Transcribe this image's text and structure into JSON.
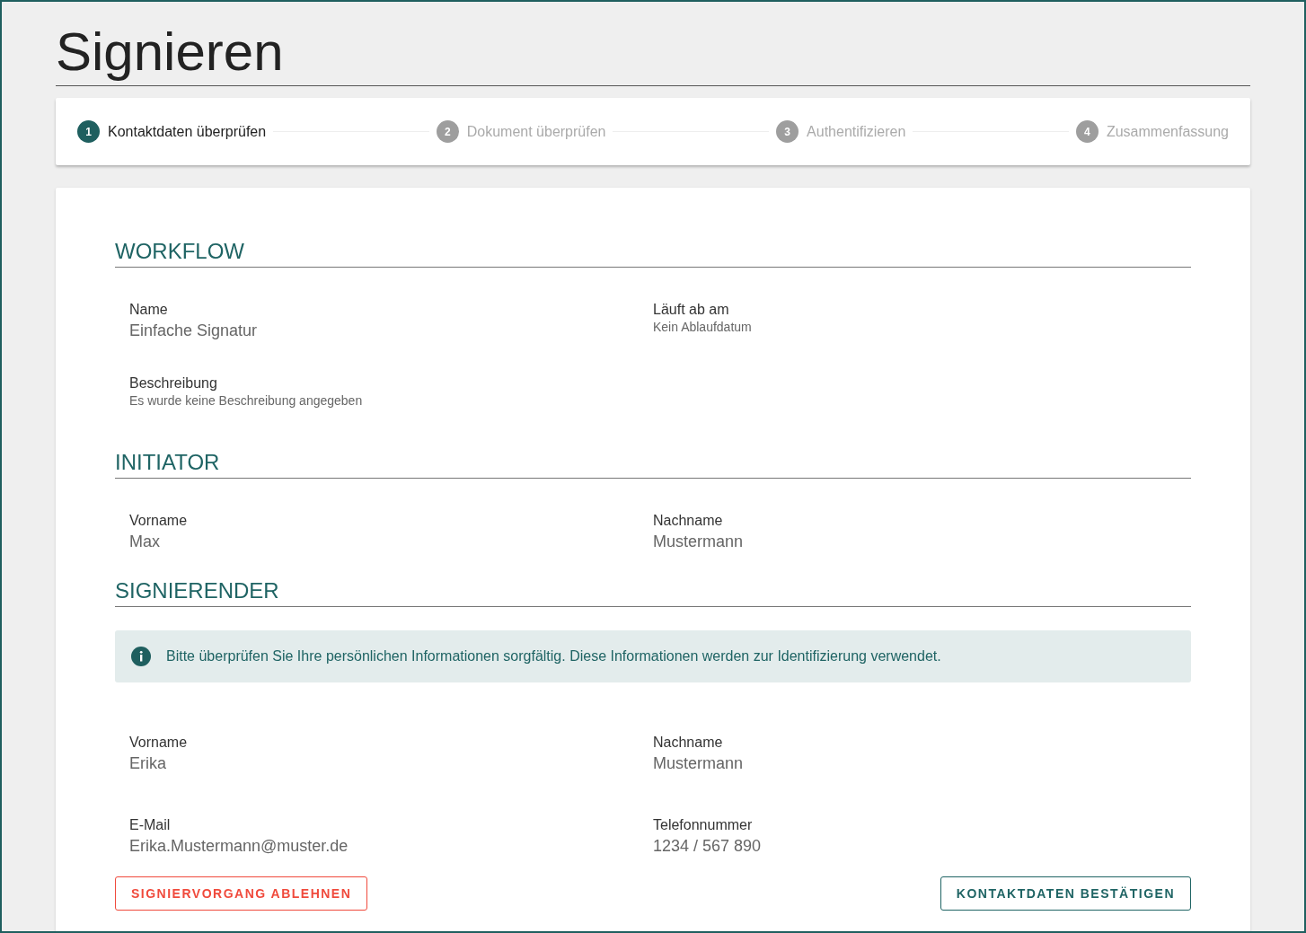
{
  "title": "Signieren",
  "steps": [
    {
      "number": "1",
      "label": "Kontaktdaten überprüfen",
      "selected": true
    },
    {
      "number": "2",
      "label": "Dokument überprüfen",
      "selected": false
    },
    {
      "number": "3",
      "label": "Authentifizieren",
      "selected": false
    },
    {
      "number": "4",
      "label": "Zusammenfassung",
      "selected": false
    }
  ],
  "sections": [
    {
      "heading": "WORKFLOW",
      "rows": [
        [
          {
            "label": "Name",
            "value": "Einfache Signatur",
            "kind": "large"
          },
          {
            "label": "Läuft ab am",
            "value": "Kein Ablaufdatum",
            "kind": "small"
          }
        ],
        [
          {
            "label": "Beschreibung",
            "value": "Es wurde keine Beschreibung angegeben",
            "kind": "small"
          }
        ]
      ]
    },
    {
      "heading": "INITIATOR",
      "rows": [
        [
          {
            "label": "Vorname",
            "value": "Max",
            "kind": "large"
          },
          {
            "label": "Nachname",
            "value": "Mustermann",
            "kind": "large"
          }
        ]
      ]
    },
    {
      "heading": "SIGNIERENDER",
      "notice": "Bitte überprüfen Sie Ihre persönlichen Informationen sorgfältig. Diese Informationen werden zur Identifizierung verwendet.",
      "rows": [
        [
          {
            "label": "Vorname",
            "value": "Erika",
            "kind": "large"
          },
          {
            "label": "Nachname",
            "value": "Mustermann",
            "kind": "large"
          }
        ],
        [
          {
            "label": "E-Mail",
            "value": "Erika.Mustermann@muster.de",
            "kind": "large"
          },
          {
            "label": "Telefonnummer",
            "value": "1234 / 567 890",
            "kind": "large"
          }
        ]
      ]
    }
  ],
  "buttons": [
    {
      "label": "SIGNIERVORGANG ABLEHNEN",
      "kind": "reject"
    },
    {
      "label": "KONTAKTDATEN BESTÄTIGEN",
      "kind": "confirm"
    }
  ]
}
